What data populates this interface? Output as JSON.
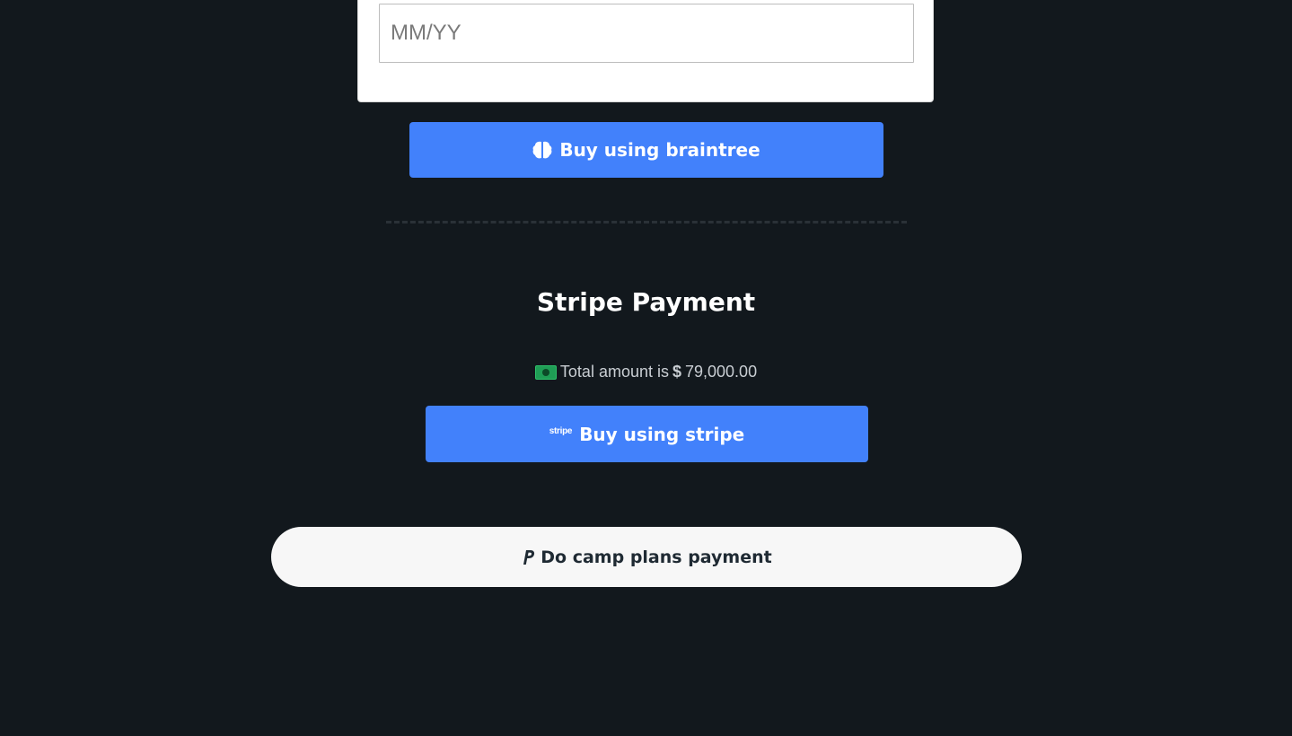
{
  "card_form": {
    "expiry_placeholder": "MM/YY",
    "expiry_value": ""
  },
  "braintree": {
    "button_label": "Buy using braintree",
    "icon": "brain-icon"
  },
  "stripe": {
    "title": "Stripe Payment",
    "amount_prefix": "Total amount is",
    "currency_symbol": "$",
    "amount": "79,000.00",
    "money_icon": "money-bill-icon",
    "logo_text": "stripe",
    "button_label": "Buy using stripe"
  },
  "paypal": {
    "button_label": "Do camp plans payment",
    "icon": "paypal-icon"
  },
  "colors": {
    "background": "#12181d",
    "primary_button": "#4281fb",
    "paypal_button": "#f7f7f7"
  }
}
